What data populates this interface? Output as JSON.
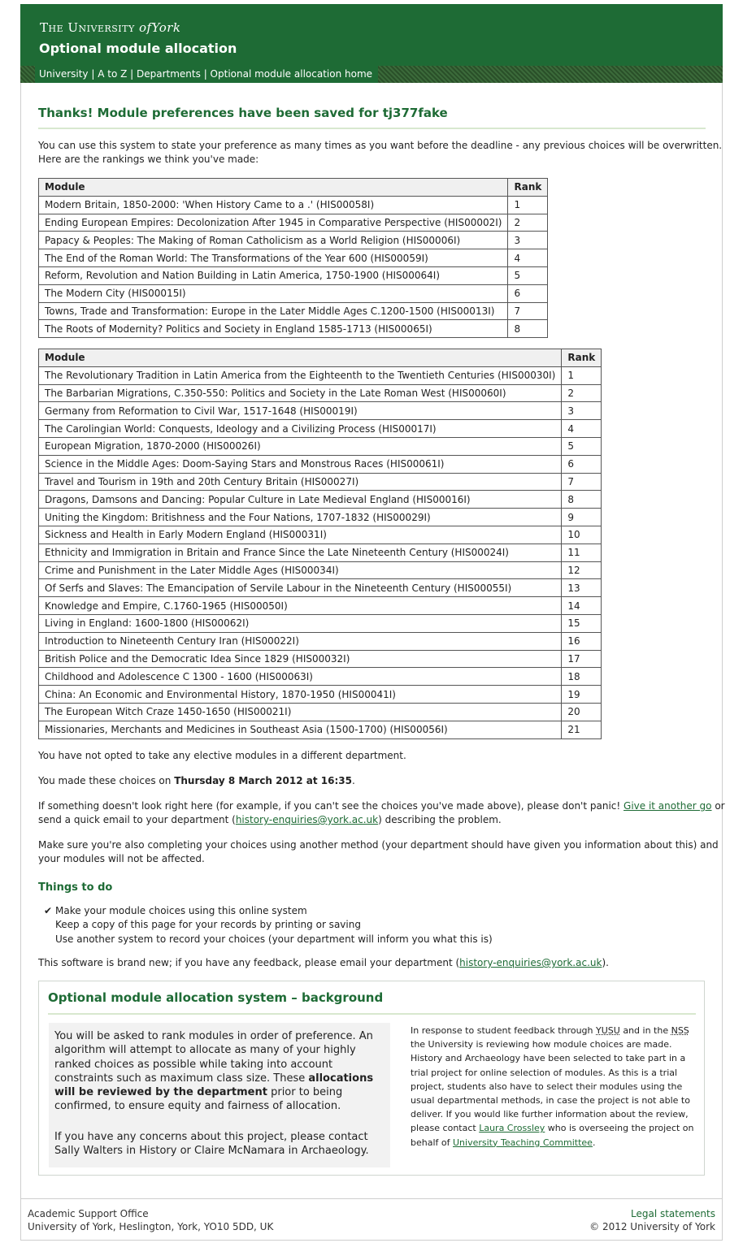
{
  "header": {
    "logo_pre": "The University",
    "logo_of": "of",
    "logo_post": "York",
    "site_title": "Optional module allocation"
  },
  "nav": {
    "university": "University",
    "atoz": "A to Z",
    "departments": "Departments",
    "home": "Optional module allocation home",
    "sep": " | "
  },
  "main": {
    "heading": "Thanks! Module preferences have been saved for tj377fake",
    "intro_line1": "You can use this system to state your preference as many times as you want before the deadline - any previous choices will be overwritten.",
    "intro_line2": "Here are the rankings we think you've made:",
    "table_headers": {
      "module": "Module",
      "rank": "Rank"
    },
    "table1": [
      {
        "module": "Modern Britain, 1850-2000: 'When History Came to a .' (HIS00058I)",
        "rank": "1"
      },
      {
        "module": "Ending European Empires: Decolonization After 1945 in Comparative Perspective (HIS00002I)",
        "rank": "2"
      },
      {
        "module": "Papacy & Peoples: The Making of Roman Catholicism as a World Religion (HIS00006I)",
        "rank": "3"
      },
      {
        "module": "The End of the Roman World: The Transformations of the Year 600 (HIS00059I)",
        "rank": "4"
      },
      {
        "module": "Reform, Revolution and Nation Building in Latin America, 1750-1900 (HIS00064I)",
        "rank": "5"
      },
      {
        "module": "The Modern City (HIS00015I)",
        "rank": "6"
      },
      {
        "module": "Towns, Trade and Transformation: Europe in the Later Middle Ages C.1200-1500 (HIS00013I)",
        "rank": "7"
      },
      {
        "module": "The Roots of Modernity? Politics and Society in England 1585-1713 (HIS00065I)",
        "rank": "8"
      }
    ],
    "table2": [
      {
        "module": "The Revolutionary Tradition in Latin America from the Eighteenth to the Twentieth Centuries (HIS00030I)",
        "rank": "1"
      },
      {
        "module": "The Barbarian Migrations, C.350-550: Politics and Society in the Late Roman West (HIS00060I)",
        "rank": "2"
      },
      {
        "module": "Germany from Reformation to Civil War, 1517-1648 (HIS00019I)",
        "rank": "3"
      },
      {
        "module": "The Carolingian World: Conquests, Ideology and a Civilizing Process (HIS00017I)",
        "rank": "4"
      },
      {
        "module": "European Migration, 1870-2000 (HIS00026I)",
        "rank": "5"
      },
      {
        "module": "Science in the Middle Ages: Doom-Saying Stars and Monstrous Races (HIS00061I)",
        "rank": "6"
      },
      {
        "module": "Travel and Tourism in 19th and 20th Century Britain (HIS00027I)",
        "rank": "7"
      },
      {
        "module": "Dragons, Damsons and Dancing: Popular Culture in Late Medieval England (HIS00016I)",
        "rank": "8"
      },
      {
        "module": "Uniting the Kingdom: Britishness and the Four Nations, 1707-1832 (HIS00029I)",
        "rank": "9"
      },
      {
        "module": "Sickness and Health in Early Modern England (HIS00031I)",
        "rank": "10"
      },
      {
        "module": "Ethnicity and Immigration in Britain and France Since the Late Nineteenth Century (HIS00024I)",
        "rank": "11"
      },
      {
        "module": "Crime and Punishment in the Later Middle Ages (HIS00034I)",
        "rank": "12"
      },
      {
        "module": "Of Serfs and Slaves: The Emancipation of Servile Labour in the Nineteenth Century (HIS00055I)",
        "rank": "13"
      },
      {
        "module": "Knowledge and Empire, C.1760-1965 (HIS00050I)",
        "rank": "14"
      },
      {
        "module": "Living in England: 1600-1800 (HIS00062I)",
        "rank": "15"
      },
      {
        "module": "Introduction to Nineteenth Century Iran (HIS00022I)",
        "rank": "16"
      },
      {
        "module": "British Police and the Democratic Idea Since 1829 (HIS00032I)",
        "rank": "17"
      },
      {
        "module": "Childhood and Adolescence C 1300 - 1600 (HIS00063I)",
        "rank": "18"
      },
      {
        "module": "China: An Economic and Environmental History, 1870-1950 (HIS00041I)",
        "rank": "19"
      },
      {
        "module": "The European Witch Craze 1450-1650 (HIS00021I)",
        "rank": "20"
      },
      {
        "module": "Missionaries, Merchants and Medicines in Southeast Asia (1500-1700) (HIS00056I)",
        "rank": "21"
      }
    ],
    "elective_note": "You have not opted to take any elective modules in a different department.",
    "choices_pre": "You made these choices on ",
    "choices_date": "Thursday 8 March 2012 at 16:35",
    "choices_post": ".",
    "help_pre": "If something doesn't look right here (for example, if you can't see the choices you've made above), please don't panic! ",
    "help_link": "Give it another go",
    "help_mid": " or",
    "help_line2_pre": "send a quick email to your department (",
    "help_email": "history-enquiries@york.ac.uk",
    "help_line2_post": ") describing the problem.",
    "other_line1": "Make sure you're also completing your choices using another method (your department should have given you information about this) and",
    "other_line2": "your modules will not be affected.",
    "things_heading": "Things to do",
    "todo": [
      {
        "check": "✔",
        "text": "Make your module choices using this online system"
      },
      {
        "check": "",
        "text": "Keep a copy of this page for your records by printing or saving"
      },
      {
        "check": "",
        "text": "Use another system to record your choices (your department will inform you what this is)"
      }
    ],
    "feedback_pre": "This software is brand new; if you have any feedback, please email your department (",
    "feedback_email": "history-enquiries@york.ac.uk",
    "feedback_post": ")."
  },
  "background": {
    "title": "Optional module allocation system – background",
    "para1_a": "You will be asked to rank modules in order of preference. An algorithm will attempt to allocate as many of your highly ranked choices as possible while taking into account constraints such as maximum class size. These ",
    "para1_bold": "allocations will be reviewed by the department",
    "para1_b": " prior to being confirmed, to ensure equity and fairness of allocation.",
    "para2": "If you have any concerns about this project, please contact Sally Walters in History or Claire McNamara in Archaeology.",
    "side_a": "In response to student feedback through ",
    "side_yusu": "YUSU",
    "side_b": " and in the ",
    "side_nss": "NSS",
    "side_c": " the University is reviewing how module choices are made. History and Archaeology have been selected to take part in a trial project for online selection of modules. As this is a trial project, students also have to select their modules using the usual departmental methods, in case the project is not able to deliver. If you would like further information about the review, please contact ",
    "side_contact": "Laura Crossley",
    "side_d": " who is overseeing the project on behalf of ",
    "side_committee": "University Teaching Committee",
    "side_e": "."
  },
  "footer": {
    "office": "Academic Support Office",
    "address": "University of York, Heslington, York, YO10 5DD, UK",
    "legal": "Legal statements",
    "copyright": "© 2012 University of York"
  },
  "colors": {
    "brand": "#1e6b35",
    "nav_bg": "#2f5a30"
  }
}
